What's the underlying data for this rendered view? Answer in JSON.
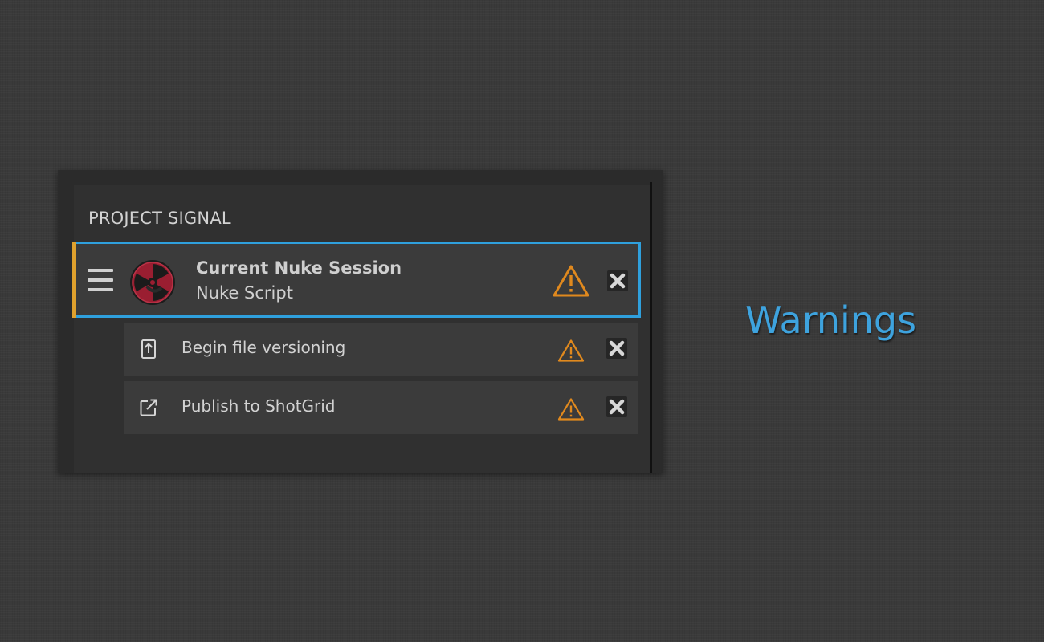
{
  "panel": {
    "title": "PROJECT SIGNAL"
  },
  "session": {
    "title": "Current Nuke Session",
    "subtitle": "Nuke Script",
    "status": "warning",
    "icon": "nuke-logo-icon"
  },
  "steps": [
    {
      "label": "Begin file versioning",
      "icon": "upload-file-icon",
      "status": "warning"
    },
    {
      "label": "Publish to ShotGrid",
      "icon": "external-link-icon",
      "status": "warning"
    }
  ],
  "caption": "Warnings",
  "colors": {
    "selection_border": "#2fa0dd",
    "accent_bar": "#e0a12d",
    "warning": "#e0891e",
    "caption": "#3ea3de",
    "nuke_red": "#8e1b2c"
  }
}
